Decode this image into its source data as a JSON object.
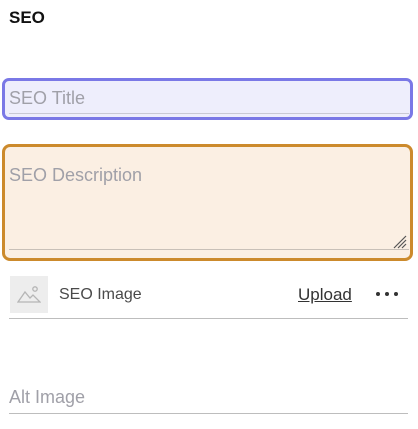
{
  "section": {
    "title": "SEO"
  },
  "fields": {
    "seo_title": {
      "placeholder": "SEO Title",
      "value": "",
      "focus_color": "#7a78e6",
      "background": "#eeeefc"
    },
    "seo_description": {
      "placeholder": "SEO Description",
      "value": "",
      "focus_color": "#cc8a2c",
      "background": "#fbefe3"
    },
    "seo_image": {
      "label": "SEO Image",
      "upload_label": "Upload",
      "more_icon": "ellipsis-icon",
      "thumbnail_icon": "image-placeholder-icon"
    },
    "alt_image": {
      "placeholder": "Alt Image",
      "value": ""
    }
  }
}
